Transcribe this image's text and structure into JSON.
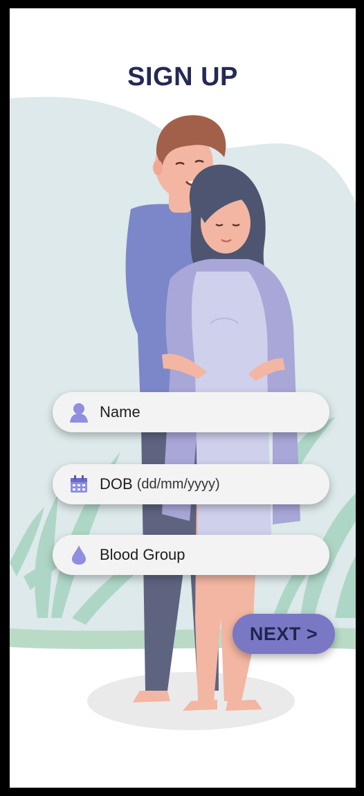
{
  "header": {
    "title": "SIGN UP"
  },
  "form": {
    "name": {
      "label": "Name"
    },
    "dob": {
      "label": "DOB",
      "hint": "(dd/mm/yyyy)"
    },
    "blood_group": {
      "label": "Blood Group"
    },
    "next_label": "NEXT >"
  },
  "icons": {
    "name": "person-icon",
    "dob": "calendar-icon",
    "blood_group": "blood-drop-icon"
  },
  "colors": {
    "title": "#222a55",
    "accent": "#7a78c4",
    "icon": "#8f8ee0",
    "field_bg": "#f3f3f3"
  }
}
